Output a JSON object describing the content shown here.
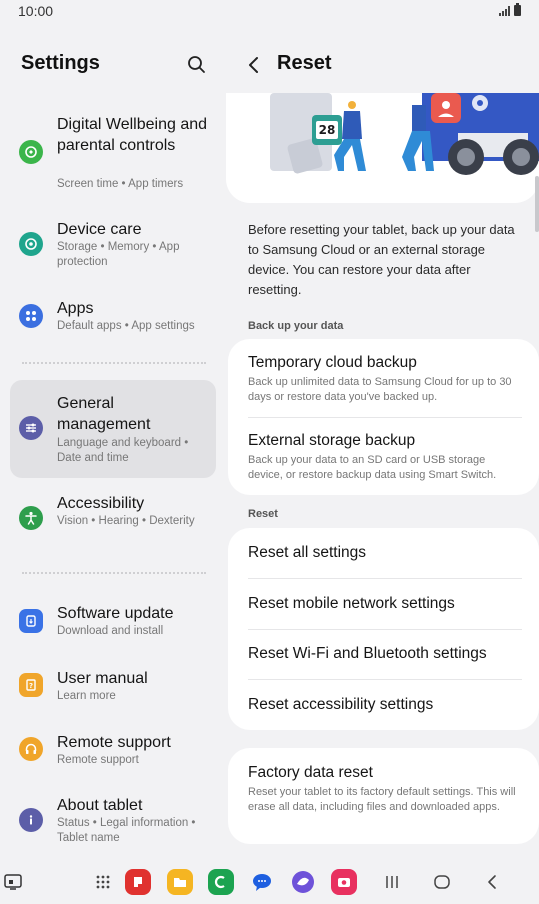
{
  "status": {
    "time": "10:00"
  },
  "left": {
    "title": "Settings",
    "items": [
      {
        "title": "Digital Wellbeing and parental controls",
        "sub": "Screen time  •  App timers",
        "color": "#3bb54a",
        "icon": "wellbeing-icon"
      },
      {
        "title": "Device care",
        "sub": "Storage  •  Memory  •  App protection",
        "color": "#1fa58d",
        "icon": "device-care-icon"
      },
      {
        "title": "Apps",
        "sub": "Default apps  •  App settings",
        "color": "#3b6fe0",
        "icon": "apps-icon"
      },
      {
        "title": "General management",
        "sub": "Language and keyboard  •  Date and time",
        "color": "#5c5ea8",
        "icon": "sliders-icon"
      },
      {
        "title": "Accessibility",
        "sub": "Vision  •  Hearing  •  Dexterity",
        "color": "#2e9e4c",
        "icon": "accessibility-icon"
      },
      {
        "title": "Software update",
        "sub": "Download and install",
        "color": "#3a72e6",
        "icon": "software-update-icon"
      },
      {
        "title": "User manual",
        "sub": "Learn more",
        "color": "#f0a52a",
        "icon": "user-manual-icon"
      },
      {
        "title": "Remote support",
        "sub": "Remote support",
        "color": "#f0a52a",
        "icon": "headset-icon"
      },
      {
        "title": "About tablet",
        "sub": "Status  •  Legal information  •  Tablet name",
        "color": "#5c5ea8",
        "icon": "info-icon"
      }
    ]
  },
  "right": {
    "title": "Reset",
    "hero_date": "28",
    "description": "Before resetting your tablet, back up your data to Samsung Cloud or an external storage device. You can restore your data after resetting.",
    "backup_label": "Back up your data",
    "backup": [
      {
        "title": "Temporary cloud backup",
        "sub": "Back up unlimited data to Samsung Cloud for up to 30 days or restore data you've backed up."
      },
      {
        "title": "External storage backup",
        "sub": "Back up your data to an SD card or USB storage device, or restore backup data using Smart Switch."
      }
    ],
    "reset_label": "Reset",
    "reset": [
      {
        "title": "Reset all settings"
      },
      {
        "title": "Reset mobile network settings"
      },
      {
        "title": "Reset Wi-Fi and Bluetooth settings"
      },
      {
        "title": "Reset accessibility settings"
      }
    ],
    "factory": {
      "title": "Factory data reset",
      "sub": "Reset your tablet to its factory default settings. This will erase all data, including files and downloaded apps."
    }
  },
  "colors": {
    "selected": "#e1e1e4",
    "card": "#ffffff",
    "background": "#f2f2f4"
  }
}
